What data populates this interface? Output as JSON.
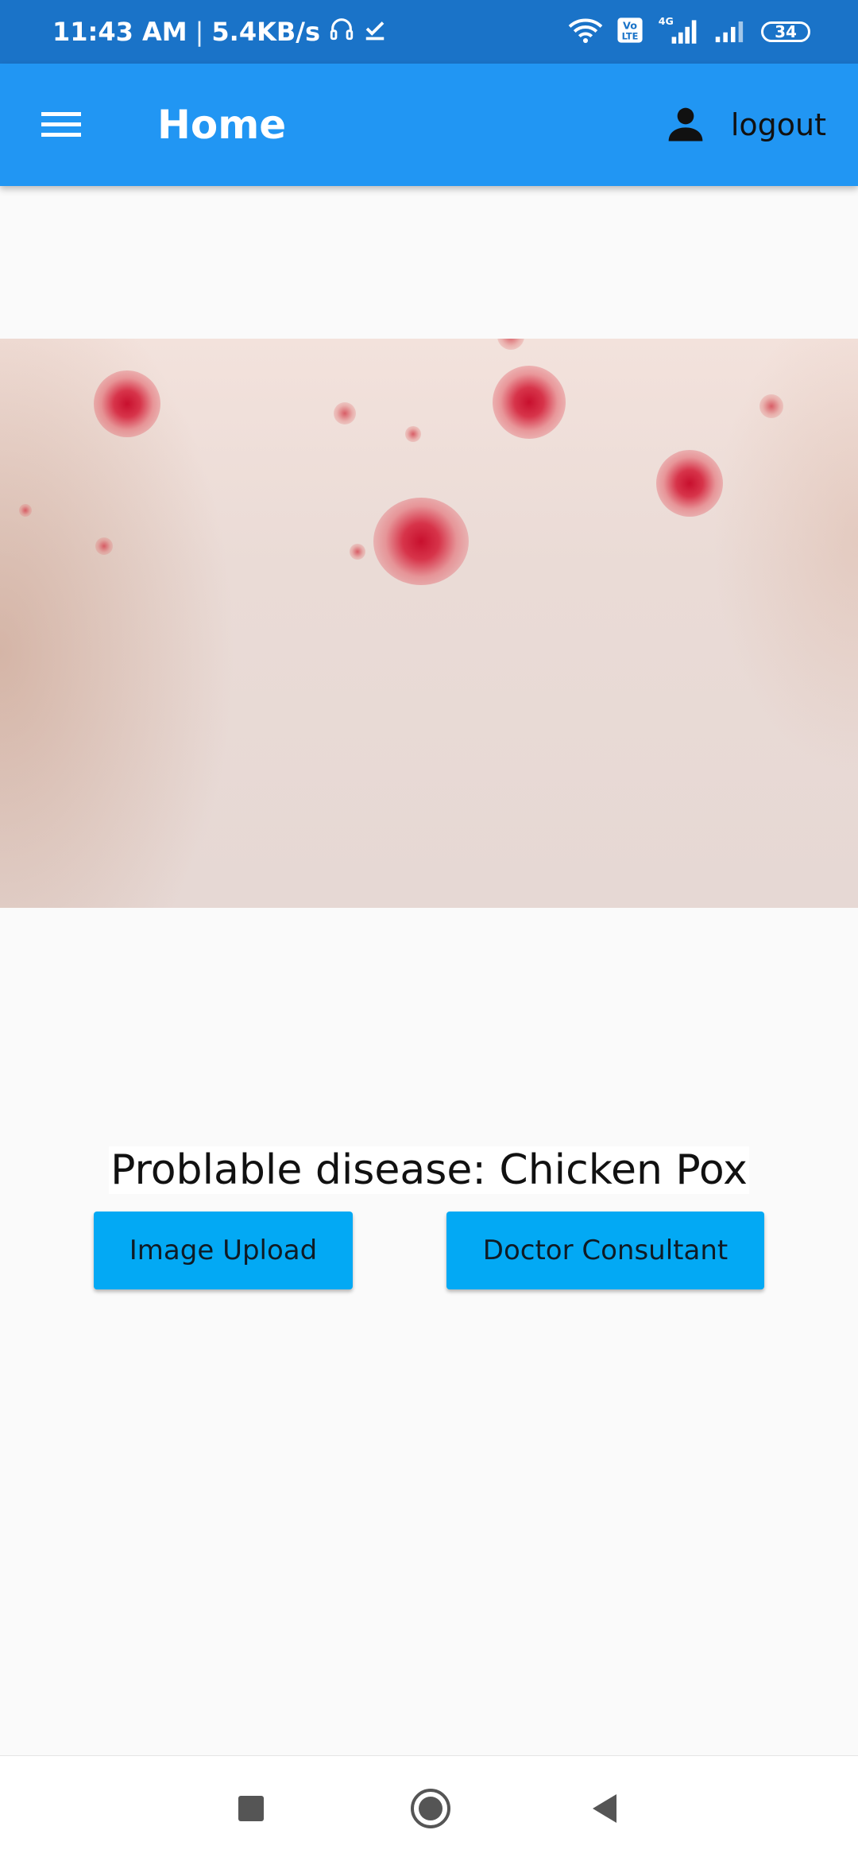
{
  "status_bar": {
    "time": "11:43 AM",
    "separator": "|",
    "speed": "5.4KB/s",
    "icons": [
      "headset-icon",
      "check-download-icon",
      "wifi-icon",
      "volte-icon",
      "signal-4g-icon",
      "signal-icon"
    ],
    "volte_label": "Vo\nLTE",
    "network_label": "4G",
    "battery": "34"
  },
  "app_bar": {
    "title": "Home",
    "logout_label": "logout",
    "background": "#2196f3"
  },
  "image": {
    "icon": "skin-rash-photo"
  },
  "result": {
    "text": "Problable disease: Chicken Pox"
  },
  "buttons": {
    "upload_label": "Image Upload",
    "doctor_label": "Doctor Consultant",
    "color": "#03a9f4"
  },
  "nav_bar": {
    "icons": [
      "recent-apps-icon",
      "home-icon",
      "back-icon"
    ]
  }
}
